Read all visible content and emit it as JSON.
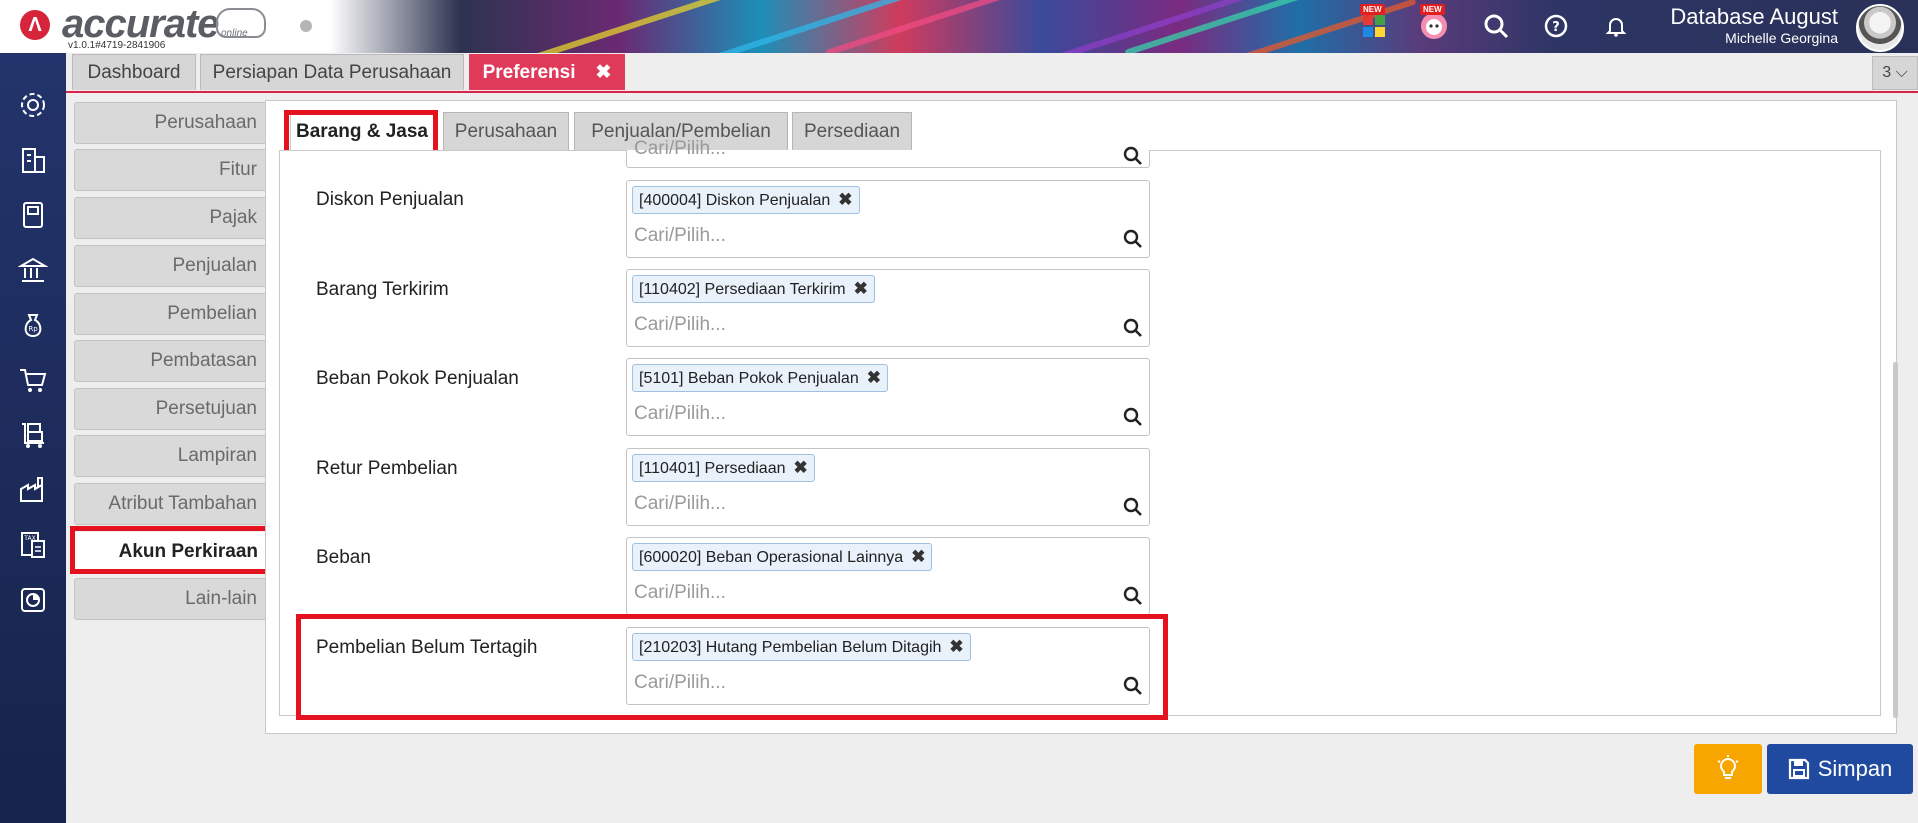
{
  "app": {
    "logo_text": "accurate",
    "logo_sub": "online",
    "version": "v1.0.1#4719-2841906",
    "new_badge": "NEW",
    "database": "Database August",
    "user": "Michelle Georgina"
  },
  "main_tabs": [
    {
      "label": "Dashboard"
    },
    {
      "label": "Persiapan Data Perusahaan"
    },
    {
      "label": "Preferensi",
      "close": "✖"
    }
  ],
  "tab_count": "3 ⌵",
  "pref_menu": [
    {
      "label": "Perusahaan"
    },
    {
      "label": "Fitur"
    },
    {
      "label": "Pajak"
    },
    {
      "label": "Penjualan"
    },
    {
      "label": "Pembelian"
    },
    {
      "label": "Pembatasan"
    },
    {
      "label": "Persetujuan"
    },
    {
      "label": "Lampiran"
    },
    {
      "label": "Atribut Tambahan"
    },
    {
      "label": "Akun Perkiraan"
    },
    {
      "label": "Lain-lain"
    }
  ],
  "sub_tabs": [
    {
      "label": "Barang & Jasa"
    },
    {
      "label": "Perusahaan"
    },
    {
      "label": "Penjualan/Pembelian"
    },
    {
      "label": "Persediaan"
    }
  ],
  "rows": [
    {
      "label": "Diskon Penjualan",
      "value": "[400004] Diskon Penjualan"
    },
    {
      "label": "Barang Terkirim",
      "value": "[110402] Persediaan Terkirim"
    },
    {
      "label": "Beban Pokok Penjualan",
      "value": "[5101] Beban Pokok Penjualan"
    },
    {
      "label": "Retur Pembelian",
      "value": "[110401] Persediaan"
    },
    {
      "label": "Beban",
      "value": "[600020] Beban Operasional Lainnya"
    },
    {
      "label": "Pembelian Belum Tertagih",
      "value": "[210203] Hutang Pembelian Belum Ditagih"
    }
  ],
  "field_placeholder": "Cari/Pilih...",
  "partial_placeholder": "Cari/Pilih...",
  "chip_remove": "✖",
  "buttons": {
    "save": "Simpan"
  },
  "colors": {
    "accent": "#e03a5a",
    "highlight": "#e4121e",
    "save": "#1f4aa0",
    "tip": "#f7a600"
  }
}
